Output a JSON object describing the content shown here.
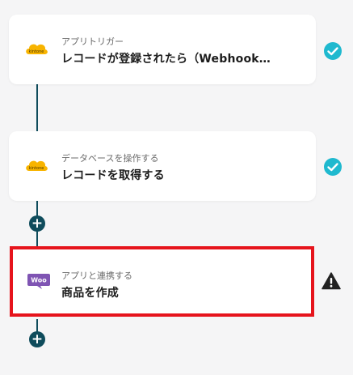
{
  "flow": {
    "steps": [
      {
        "subtitle": "アプリトリガー",
        "title": "レコードが登録されたら（Webhook…",
        "app_icon": "kintone-icon",
        "app_logo_text": "kintone",
        "status_icon": "check-circle-icon"
      },
      {
        "subtitle": "データベースを操作する",
        "title": "レコードを取得する",
        "app_icon": "kintone-icon",
        "app_logo_text": "kintone",
        "status_icon": "check-circle-icon"
      },
      {
        "subtitle": "アプリと連携する",
        "title": "商品を作成",
        "app_icon": "woocommerce-icon",
        "app_logo_text": "Woo",
        "status_icon": "warning-icon",
        "highlighted": true
      }
    ],
    "add_button_label": "+"
  },
  "colors": {
    "background": "#f5f5f6",
    "connector": "#0f4c5c",
    "success": "#1fb9cf",
    "warning": "#222222",
    "highlight_border": "#e6141c",
    "kintone": "#f8b400",
    "woocommerce": "#7f54b3"
  }
}
